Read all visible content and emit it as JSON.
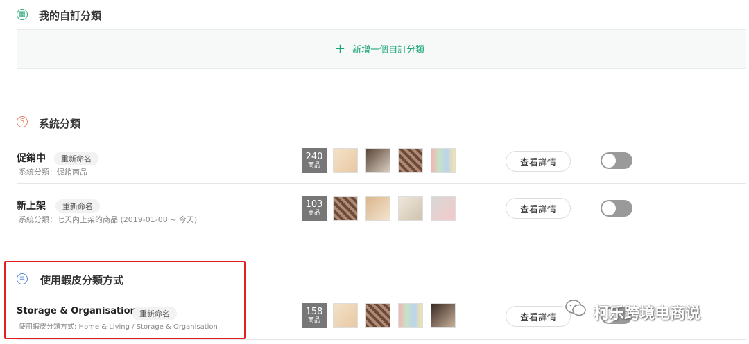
{
  "custom_section": {
    "title": "我的自訂分類",
    "add_label": "新增一個自訂分類"
  },
  "system_section": {
    "title": "系統分類",
    "rows": [
      {
        "name": "促銷中",
        "rename": "重新命名",
        "subtitle": "系統分類：促銷商品",
        "count": "240",
        "count_unit": "商品",
        "details": "查看詳情"
      },
      {
        "name": "新上架",
        "rename": "重新命名",
        "subtitle": "系統分類：七天內上架的商品 (2019-01-08 ~ 今天)",
        "count": "103",
        "count_unit": "商品",
        "details": "查看詳情"
      }
    ]
  },
  "shopee_section": {
    "title": "使用蝦皮分類方式",
    "rows": [
      {
        "name": "Storage & Organisation",
        "rename": "重新命名",
        "subtitle": "使用蝦皮分類方式: Home & Living / Storage & Organisation",
        "count": "158",
        "count_unit": "商品",
        "details": "查看詳情"
      }
    ]
  },
  "watermark": "柯乐跨境电商说",
  "colors": {
    "accent_green": "#1aa37a",
    "highlight_red": "#e02020",
    "toggle_off": "#9a9a9a"
  }
}
